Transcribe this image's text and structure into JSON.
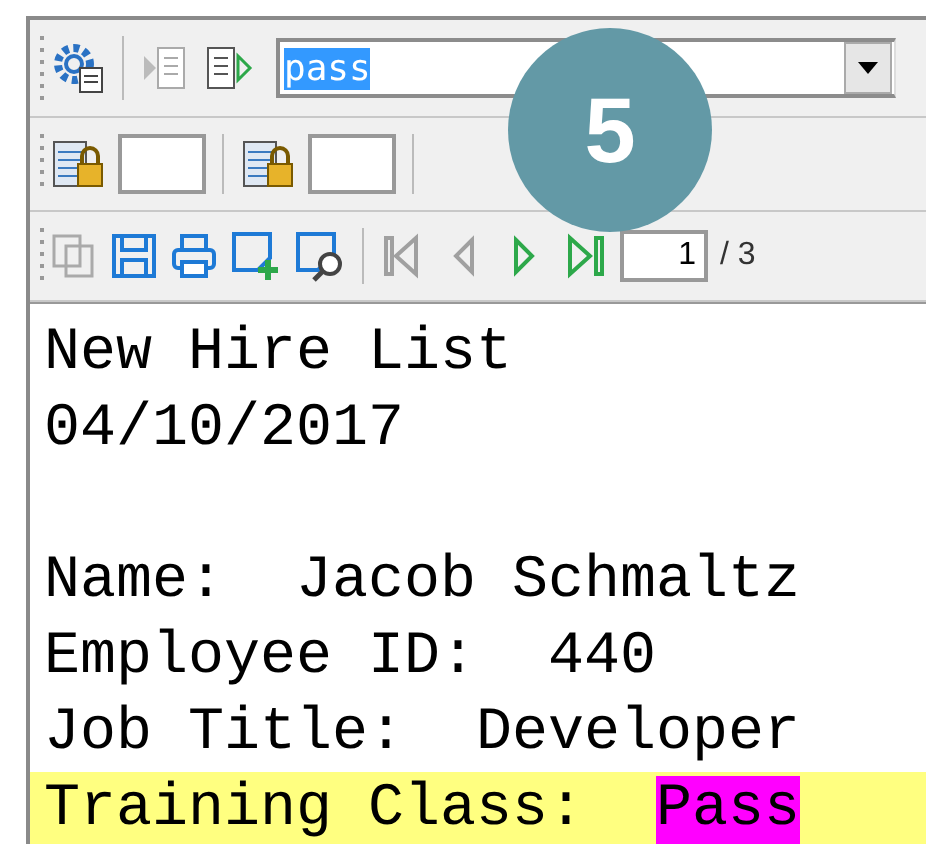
{
  "search": {
    "value": "pass",
    "selected_text": true
  },
  "nav": [
    {
      "kind": "first",
      "disabled": true
    },
    {
      "kind": "prev",
      "disabled": true
    },
    {
      "kind": "next",
      "disabled": false
    },
    {
      "kind": "last",
      "disabled": false
    }
  ],
  "page": {
    "value": "1",
    "total": "/ 3"
  },
  "document": {
    "lines": [
      {
        "kind": "text",
        "text": "New Hire List"
      },
      {
        "kind": "text",
        "text": "04/10/2017"
      },
      {
        "kind": "blank"
      },
      {
        "kind": "field",
        "label": "Name:",
        "value": "Jacob Schmaltz",
        "highlighted": false,
        "match": false
      },
      {
        "kind": "field",
        "label": "Employee ID:",
        "value": "440",
        "highlighted": false,
        "match": false
      },
      {
        "kind": "field",
        "label": "Job Title:",
        "value": "Developer",
        "highlighted": false,
        "match": false
      },
      {
        "kind": "field",
        "label": "Training Class:",
        "value": "Pass",
        "highlighted": true,
        "match": true
      }
    ]
  },
  "step_badge": "5"
}
